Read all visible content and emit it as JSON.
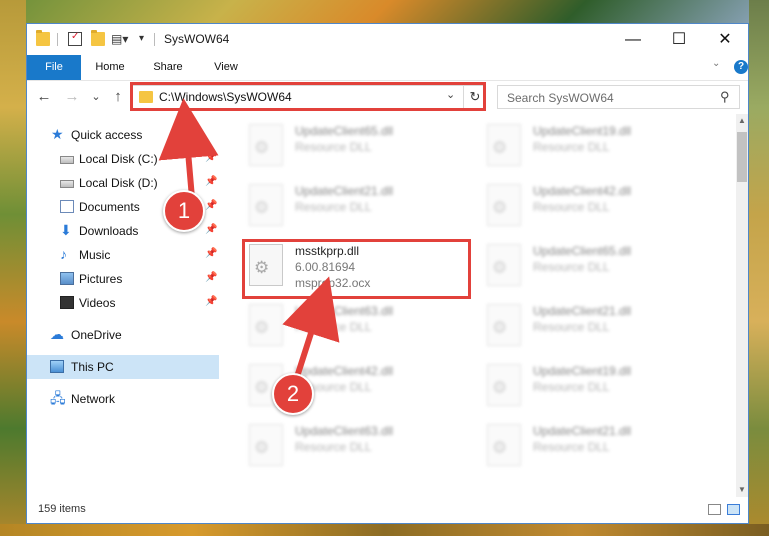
{
  "window": {
    "title": "SysWOW64",
    "minimize": "—",
    "maximize": "☐",
    "close": "✕"
  },
  "ribbon": {
    "tabs": [
      "File",
      "Home",
      "Share",
      "View"
    ],
    "help": "?"
  },
  "navigation": {
    "back": "←",
    "forward": "→",
    "recent": "⌄",
    "up": "↑",
    "address": "C:\\Windows\\SysWOW64",
    "address_dropdown": "⌄",
    "refresh": "↻",
    "search_placeholder": "Search SysWOW64"
  },
  "sidebar": {
    "items": [
      {
        "label": "Quick access",
        "icon": "star-icon",
        "pinned": false
      },
      {
        "label": "Local Disk (C:)",
        "icon": "drive-icon",
        "pinned": true
      },
      {
        "label": "Local Disk (D:)",
        "icon": "drive-icon",
        "pinned": true
      },
      {
        "label": "Documents",
        "icon": "documents-icon",
        "pinned": true
      },
      {
        "label": "Downloads",
        "icon": "download-icon",
        "pinned": true
      },
      {
        "label": "Music",
        "icon": "music-icon",
        "pinned": true
      },
      {
        "label": "Pictures",
        "icon": "pictures-icon",
        "pinned": true
      },
      {
        "label": "Videos",
        "icon": "videos-icon",
        "pinned": true
      },
      {
        "label": "OneDrive",
        "icon": "cloud-icon",
        "pinned": false
      },
      {
        "label": "This PC",
        "icon": "computer-icon",
        "pinned": false,
        "selected": true
      },
      {
        "label": "Network",
        "icon": "network-icon",
        "pinned": false
      }
    ],
    "pin_glyph": "📌"
  },
  "files": {
    "left_column": [
      {
        "name": "UpdateClient65.dll",
        "type": "Resource DLL"
      },
      {
        "name": "UpdateClient21.dll",
        "type": "Resource DLL"
      },
      {
        "name": "msstkprp.dll",
        "version": "6.00.81694",
        "original": "msprop32.ocx"
      },
      {
        "name": "UpdateClient63.dll",
        "type": "Resource DLL"
      },
      {
        "name": "UpdateClient42.dll",
        "type": "Resource DLL"
      },
      {
        "name": "UpdateClient63.dll",
        "type": "Resource DLL"
      }
    ],
    "right_column": [
      {
        "name": "UpdateClient19.dll",
        "type": "Resource DLL"
      },
      {
        "name": "UpdateClient42.dll",
        "type": "Resource DLL"
      },
      {
        "name": "UpdateClient65.dll",
        "type": "Resource DLL"
      },
      {
        "name": "UpdateClient21.dll",
        "type": "Resource DLL"
      },
      {
        "name": "UpdateClient19.dll",
        "type": "Resource DLL"
      },
      {
        "name": "UpdateClient21.dll",
        "type": "Resource DLL"
      }
    ]
  },
  "status": {
    "item_count": "159 items"
  },
  "annotations": {
    "step1": "1",
    "step2": "2",
    "color": "#e2413b"
  }
}
